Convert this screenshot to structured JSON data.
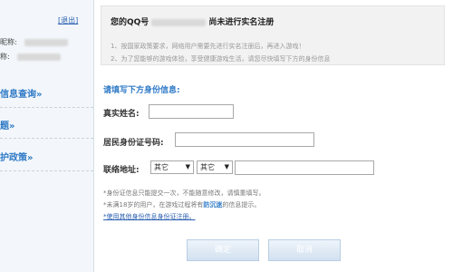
{
  "sidebar": {
    "logout_label": "[退出]",
    "meta_1_prefix": "昵称:",
    "meta_2_prefix": "称:",
    "links": [
      "信息查询»",
      "题»",
      "护政策»"
    ]
  },
  "notice": {
    "title_prefix": "您的QQ号",
    "title_suffix": "尚未进行实名注册",
    "line_1": "1、按国家政策要求，网络用户需要先进行实名注册后，再进入游戏！",
    "line_2": "2、为了您能够的游戏体验，享受健康游戏生活，请您尽快填写下方的身份信息"
  },
  "form": {
    "section_title": "请填写下方身份信息:",
    "name_label": "真实姓名:",
    "name_value": "",
    "id_label": "居民身份证号码:",
    "id_value": "",
    "address_label": "联络地址:",
    "select_1": "其它",
    "select_2": "其它",
    "address_value": ""
  },
  "tips": {
    "tip_1": "*身份证信息只能提交一次，不能随意修改，请慎重填写。",
    "tip_2_prefix": "*未满18岁的用户，在游戏过程将有",
    "tip_2_emphasis": "防沉迷",
    "tip_2_suffix": "的信息提示。",
    "tip_3_link": "*使用其他身份信息身份证注册。"
  },
  "buttons": {
    "ok_label": "确定",
    "cancel_label": "取消"
  },
  "colors": {
    "accent": "#2f7ac6",
    "sidebar_bg": "#f3f7fb",
    "notice_bg": "#f2f2f2"
  }
}
